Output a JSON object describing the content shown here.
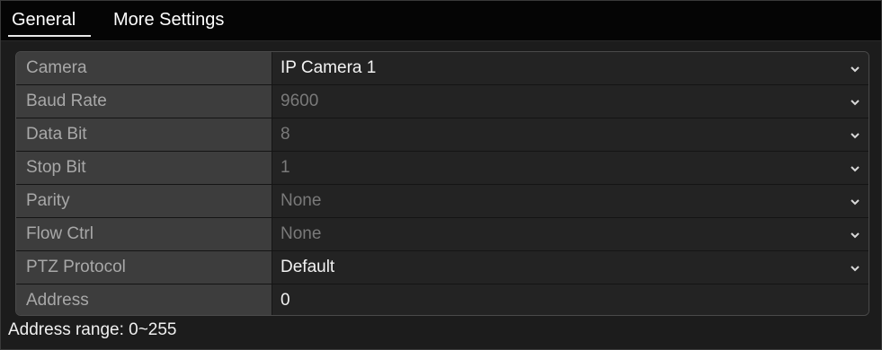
{
  "tabs": {
    "general": "General",
    "more_settings": "More Settings"
  },
  "rows": [
    {
      "label": "Camera",
      "value": "IP Camera 1",
      "dropdown": true,
      "enabled": true
    },
    {
      "label": "Baud Rate",
      "value": "9600",
      "dropdown": true,
      "enabled": false
    },
    {
      "label": "Data Bit",
      "value": "8",
      "dropdown": true,
      "enabled": false
    },
    {
      "label": "Stop Bit",
      "value": "1",
      "dropdown": true,
      "enabled": false
    },
    {
      "label": "Parity",
      "value": "None",
      "dropdown": true,
      "enabled": false
    },
    {
      "label": "Flow Ctrl",
      "value": "None",
      "dropdown": true,
      "enabled": false
    },
    {
      "label": "PTZ Protocol",
      "value": "Default",
      "dropdown": true,
      "enabled": true
    },
    {
      "label": "Address",
      "value": "0",
      "dropdown": false,
      "enabled": true
    }
  ],
  "footer": {
    "address_range": "Address range: 0~255"
  },
  "icons": {
    "dropdown": "chevron-down-icon"
  },
  "colors": {
    "tab_bar": "#050505",
    "label_cell": "#3d3d3d",
    "value_cell": "#232323",
    "text_enabled": "#f2f2f2",
    "text_disabled": "#7a7a7a"
  }
}
